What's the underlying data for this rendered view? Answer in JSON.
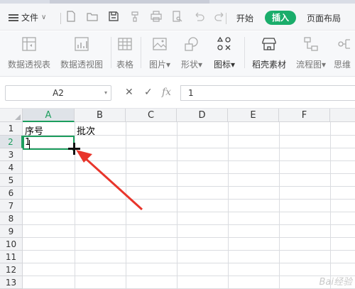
{
  "menu": {
    "file_label": "文件",
    "tabs": [
      "开始",
      "插入",
      "页面布局"
    ],
    "active_tab": "插入"
  },
  "ribbon": {
    "items": [
      {
        "label": "数据透视表",
        "icon": "pivot-table-icon"
      },
      {
        "label": "数据透视图",
        "icon": "pivot-chart-icon"
      },
      {
        "label": "表格",
        "icon": "table-icon"
      },
      {
        "label": "图片▾",
        "icon": "image-icon"
      },
      {
        "label": "形状▾",
        "icon": "shape-icon"
      },
      {
        "label": "图标▾",
        "icon": "icon-library-icon"
      },
      {
        "label": "稻壳素材",
        "icon": "store-icon"
      },
      {
        "label": "流程图▾",
        "icon": "flowchart-icon"
      },
      {
        "label": "思维",
        "icon": "mindmap-icon"
      }
    ]
  },
  "formula_bar": {
    "name_box": "A2",
    "fx": "fx",
    "value": "1"
  },
  "sheet": {
    "columns": [
      "A",
      "B",
      "C",
      "D",
      "E",
      "F"
    ],
    "rows": [
      "1",
      "2",
      "3",
      "4",
      "5",
      "6",
      "7",
      "8",
      "9",
      "10",
      "11",
      "12",
      "13"
    ],
    "cells": {
      "A1": "序号",
      "B1": "批次",
      "A2": "1"
    },
    "selected_cell": "A2"
  },
  "watermark": "Bai经验",
  "colors": {
    "accent": "#1d9e5e",
    "insert_tab": "#1aad6b",
    "arrow": "#e8352b"
  }
}
